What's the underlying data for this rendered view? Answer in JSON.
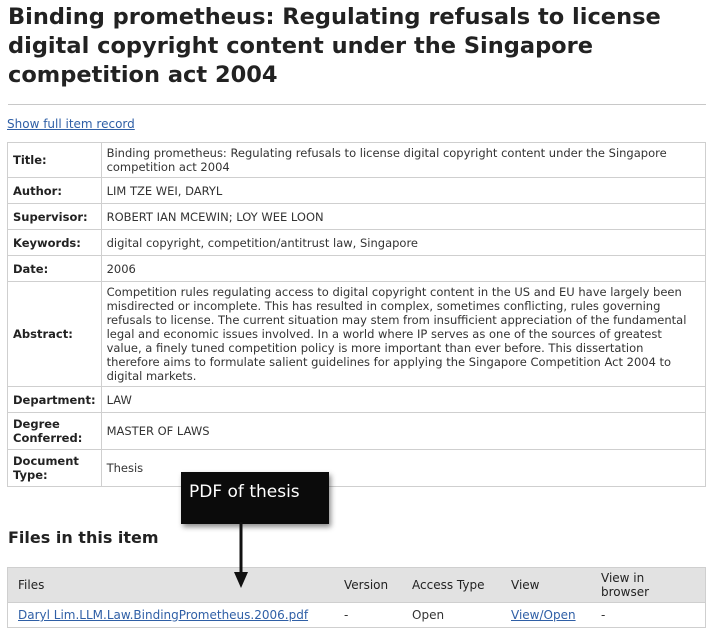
{
  "title": "Binding prometheus: Regulating refusals to license digital copyright content under the Singapore competition act 2004",
  "show_full_link": "Show full item record",
  "metadata": [
    {
      "label": "Title:",
      "value": "Binding prometheus: Regulating refusals to license digital copyright content under the Singapore competition act 2004"
    },
    {
      "label": "Author:",
      "value": "LIM TZE WEI, DARYL"
    },
    {
      "label": "Supervisor:",
      "value": "ROBERT IAN MCEWIN; LOY WEE LOON"
    },
    {
      "label": "Keywords:",
      "value": "digital copyright, competition/antitrust law, Singapore"
    },
    {
      "label": "Date:",
      "value": "2006"
    },
    {
      "label": "Abstract:",
      "value": "Competition rules regulating access to digital copyright content in the US and EU have largely been misdirected or incomplete. This has resulted in complex, sometimes conflicting, rules governing refusals to license. The current situation may stem from insufficient appreciation of the fundamental legal and economic issues involved. In a world where IP serves as one of the sources of greatest value, a finely tuned competition policy is more important than ever before. This dissertation therefore aims to formulate salient guidelines for applying the Singapore Competition Act 2004 to digital markets."
    },
    {
      "label": "Department:",
      "value": "LAW"
    },
    {
      "label": "Degree Conferred:",
      "value": "MASTER OF LAWS"
    },
    {
      "label": "Document Type:",
      "value": "Thesis"
    }
  ],
  "files_heading": "Files in this item",
  "files_table": {
    "headers": [
      "Files",
      "Version",
      "Access Type",
      "View",
      "View in browser"
    ],
    "rows": [
      {
        "file": "Daryl Lim.LLM.Law.BindingPrometheus.2006.pdf",
        "version": "-",
        "access": "Open",
        "view": "View/Open",
        "browser": "-"
      }
    ]
  },
  "callout": {
    "text": "PDF of thesis",
    "icon": "down-arrow-icon"
  },
  "colors": {
    "link": "#2f5fa6",
    "header_bg": "#e2e2e2",
    "callout_bg": "#0b0b0b"
  }
}
